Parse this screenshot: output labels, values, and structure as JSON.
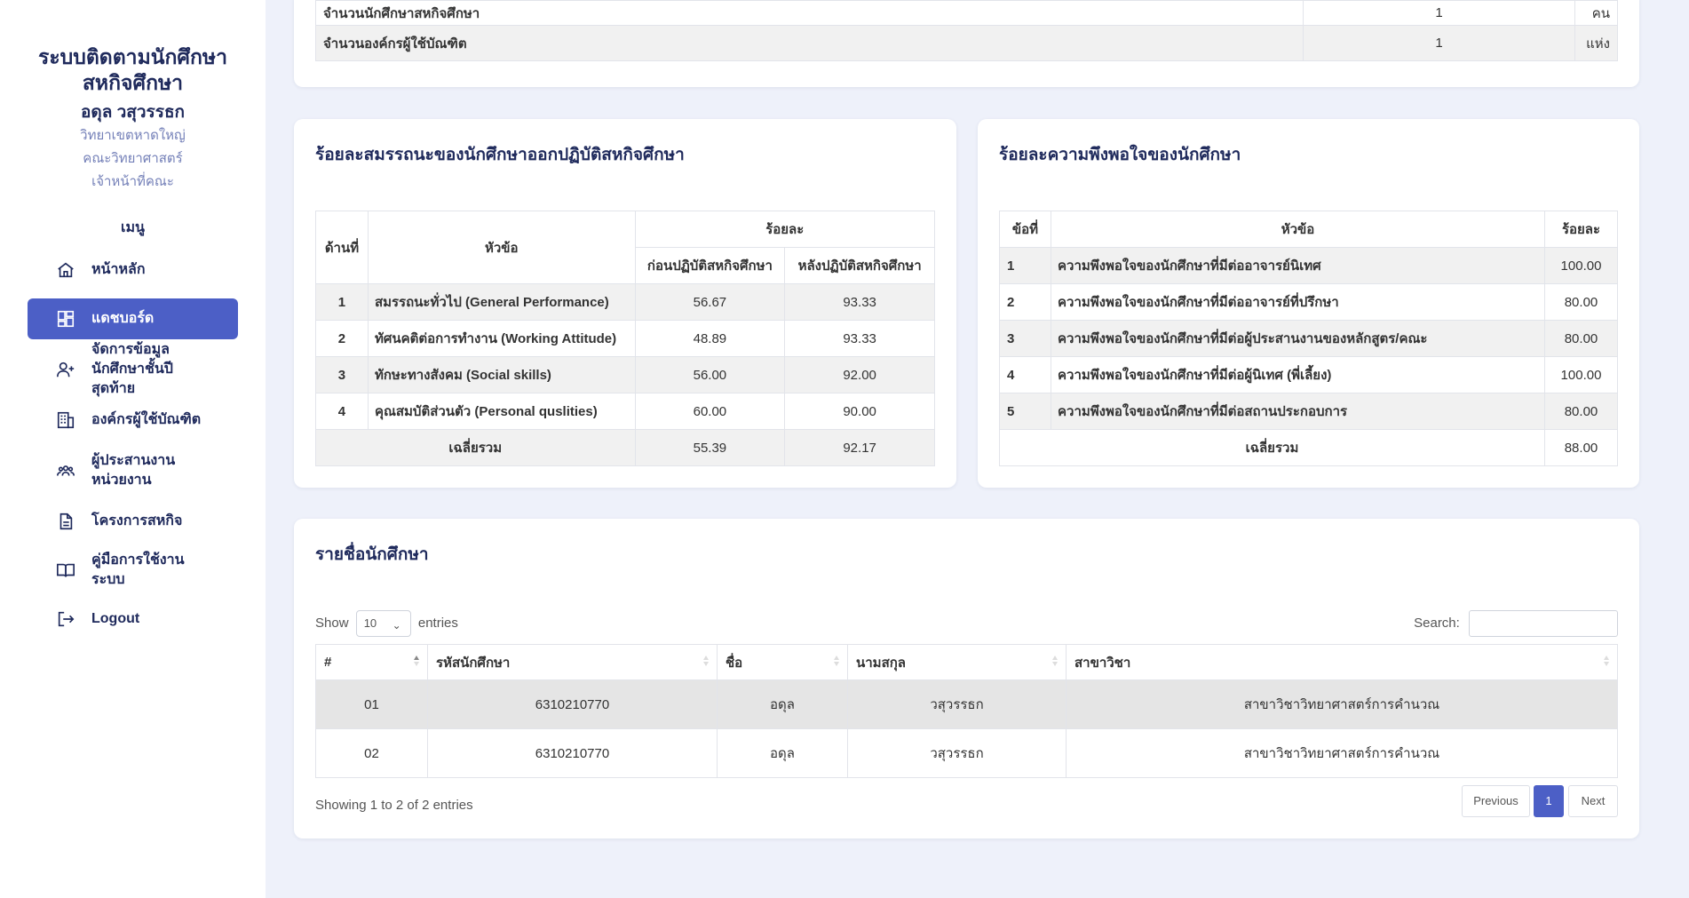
{
  "sidebar": {
    "title": "ระบบติดตามนักศึกษาสหกิจศึกษา",
    "user_name": "อดุล วสุวรรธก",
    "campus": "วิทยาเขตหาดใหญ่",
    "faculty": "คณะวิทยาศาสตร์",
    "role": "เจ้าหน้าที่คณะ",
    "menu_heading": "เมนู",
    "items": [
      {
        "label": "หน้าหลัก",
        "icon": "home-icon"
      },
      {
        "label": "แดชบอร์ด",
        "icon": "dashboard-icon",
        "active": true
      },
      {
        "label": "จัดการข้อมูลนักศึกษาชั้นปีสุดท้าย",
        "icon": "user-add-icon"
      },
      {
        "label": "องค์กรผู้ใช้บัณฑิต",
        "icon": "building-icon"
      },
      {
        "label": "ผู้ประสานงานหน่วยงาน",
        "icon": "team-icon"
      },
      {
        "label": "โครงการสหกิจ",
        "icon": "document-icon"
      },
      {
        "label": "คู่มือการใช้งานระบบ",
        "icon": "book-icon"
      },
      {
        "label": "Logout",
        "icon": "logout-icon"
      }
    ],
    "accent": "#4c5fc6"
  },
  "summary": {
    "rows": [
      {
        "label": "จำนวนนักศึกษาสหกิจศึกษา",
        "value": "1",
        "unit": "คน"
      },
      {
        "label": "จำนวนองค์กรผู้ใช้บัณฑิต",
        "value": "1",
        "unit": "แห่ง"
      }
    ]
  },
  "competency": {
    "title": "ร้อยละสมรรถนะของนักศึกษาออกปฏิบัติสหกิจศึกษา",
    "headers": {
      "no": "ด้านที่",
      "topic": "หัวข้อ",
      "percent": "ร้อยละ",
      "before": "ก่อนปฏิบัติสหกิจศึกษา",
      "after": "หลังปฏิบัติสหกิจศึกษา"
    },
    "rows": [
      {
        "no": "1",
        "topic": "สมรรถนะทั่วไป (General Performance)",
        "before": "56.67",
        "after": "93.33"
      },
      {
        "no": "2",
        "topic": "ทัศนคติต่อการทำงาน (Working Attitude)",
        "before": "48.89",
        "after": "93.33"
      },
      {
        "no": "3",
        "topic": "ทักษะทางสังคม (Social skills)",
        "before": "56.00",
        "after": "92.00"
      },
      {
        "no": "4",
        "topic": "คุณสมบัติส่วนตัว (Personal quslities)",
        "before": "60.00",
        "after": "90.00"
      }
    ],
    "avg_label": "เฉลี่ยรวม",
    "avg_before": "55.39",
    "avg_after": "92.17"
  },
  "satisfaction": {
    "title": "ร้อยละความพึงพอใจของนักศึกษา",
    "headers": {
      "no": "ข้อที่",
      "topic": "หัวข้อ",
      "percent": "ร้อยละ"
    },
    "rows": [
      {
        "no": "1",
        "topic": "ความพึงพอใจของนักศึกษาที่มีต่ออาจารย์นิเทศ",
        "percent": "100.00"
      },
      {
        "no": "2",
        "topic": "ความพึงพอใจของนักศึกษาที่มีต่ออาจารย์ที่ปรึกษา",
        "percent": "80.00"
      },
      {
        "no": "3",
        "topic": "ความพึงพอใจของนักศึกษาที่มีต่อผู้ประสานงานของหลักสูตร/คณะ",
        "percent": "80.00"
      },
      {
        "no": "4",
        "topic": "ความพึงพอใจของนักศึกษาที่มีต่อผู้นิเทศ (พี่เลี้ยง)",
        "percent": "100.00"
      },
      {
        "no": "5",
        "topic": "ความพึงพอใจของนักศึกษาที่มีต่อสถานประกอบการ",
        "percent": "80.00"
      }
    ],
    "avg_label": "เฉลี่ยรวม",
    "avg_value": "88.00"
  },
  "students": {
    "title": "รายชื่อนักศึกษา",
    "show_label": "Show",
    "entries_value": "10",
    "entries_label": "entries",
    "search_label": "Search:",
    "columns": [
      "#",
      "รหัสนักศึกษา",
      "ชื่อ",
      "นามสกุล",
      "สาขาวิชา"
    ],
    "rows": [
      {
        "no": "01",
        "id": "6310210770",
        "first": "อดุล",
        "last": "วสุวรรธก",
        "major": "สาขาวิชาวิทยาศาสตร์การคำนวณ"
      },
      {
        "no": "02",
        "id": "6310210770",
        "first": "อดุล",
        "last": "วสุวรรธก",
        "major": "สาขาวิชาวิทยาศาสตร์การคำนวณ"
      }
    ],
    "info": "Showing 1 to 2 of 2 entries",
    "prev_label": "Previous",
    "page": "1",
    "next_label": "Next"
  }
}
